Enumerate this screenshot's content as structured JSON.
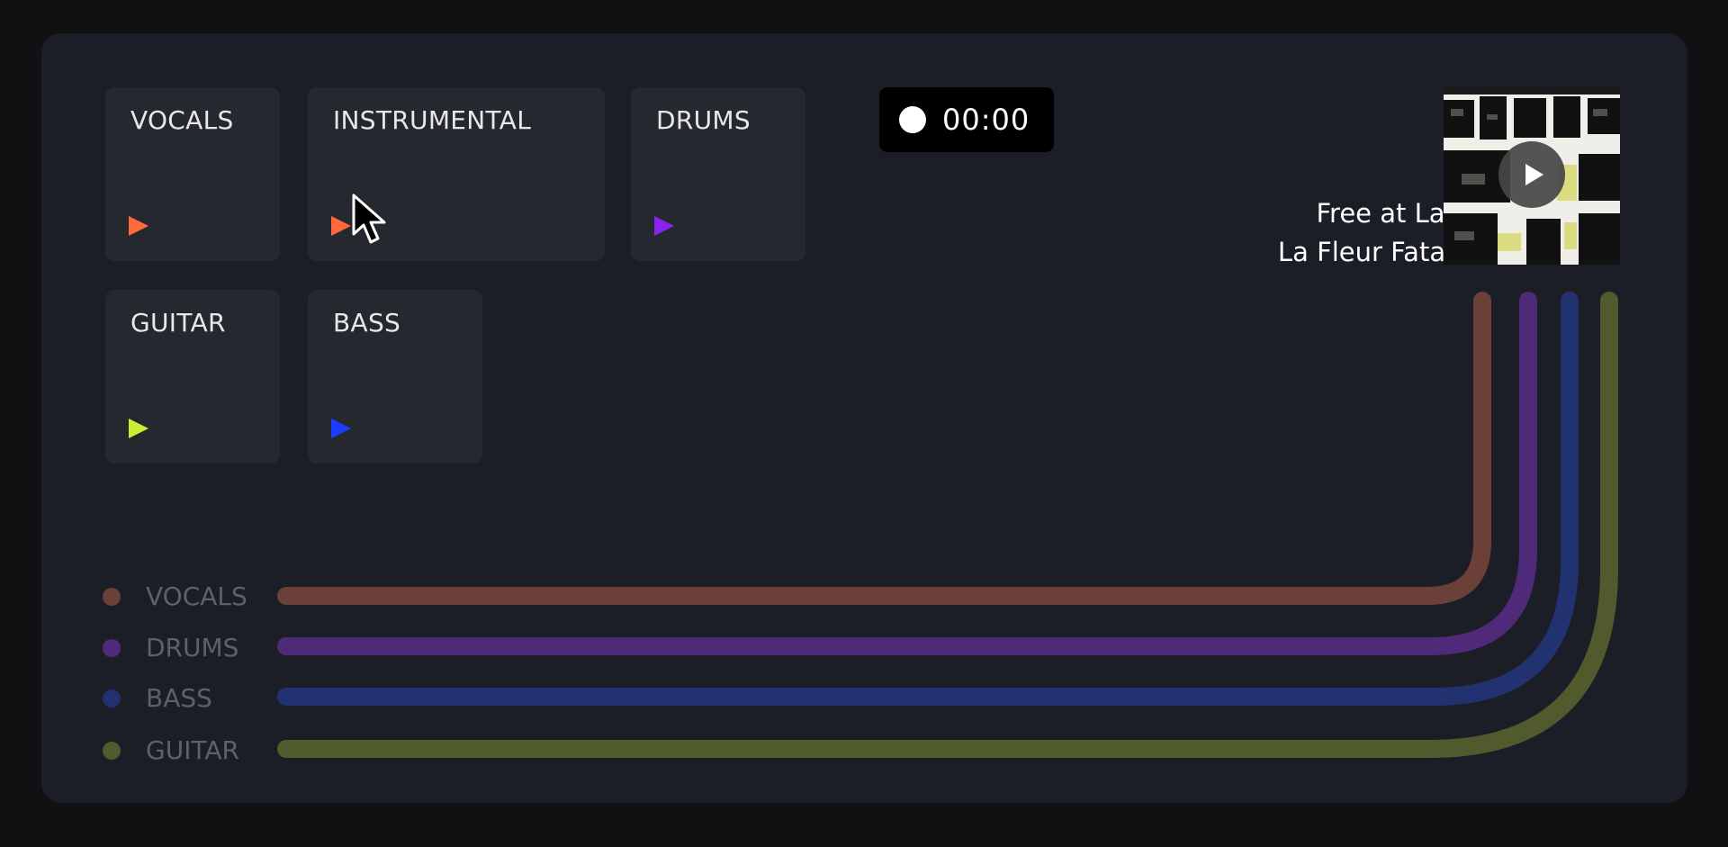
{
  "stems": [
    {
      "label": "VOCALS",
      "color": "#ff6a3d"
    },
    {
      "label": "INSTRUMENTAL",
      "color": "#ff6a3d"
    },
    {
      "label": "DRUMS",
      "color": "#8a22f0"
    },
    {
      "label": "GUITAR",
      "color": "#c9f030"
    },
    {
      "label": "BASS",
      "color": "#1e3cff"
    }
  ],
  "timer": {
    "time": "00:00"
  },
  "track": {
    "title": "Free at Last",
    "artist": "La Fleur Fatale"
  },
  "cover": {
    "icon": "play-icon"
  },
  "routes": [
    {
      "label": "VOCALS",
      "color": "#6a4038"
    },
    {
      "label": "DRUMS",
      "color": "#4e2a78"
    },
    {
      "label": "BASS",
      "color": "#223270"
    },
    {
      "label": "GUITAR",
      "color": "#515a2c"
    }
  ]
}
